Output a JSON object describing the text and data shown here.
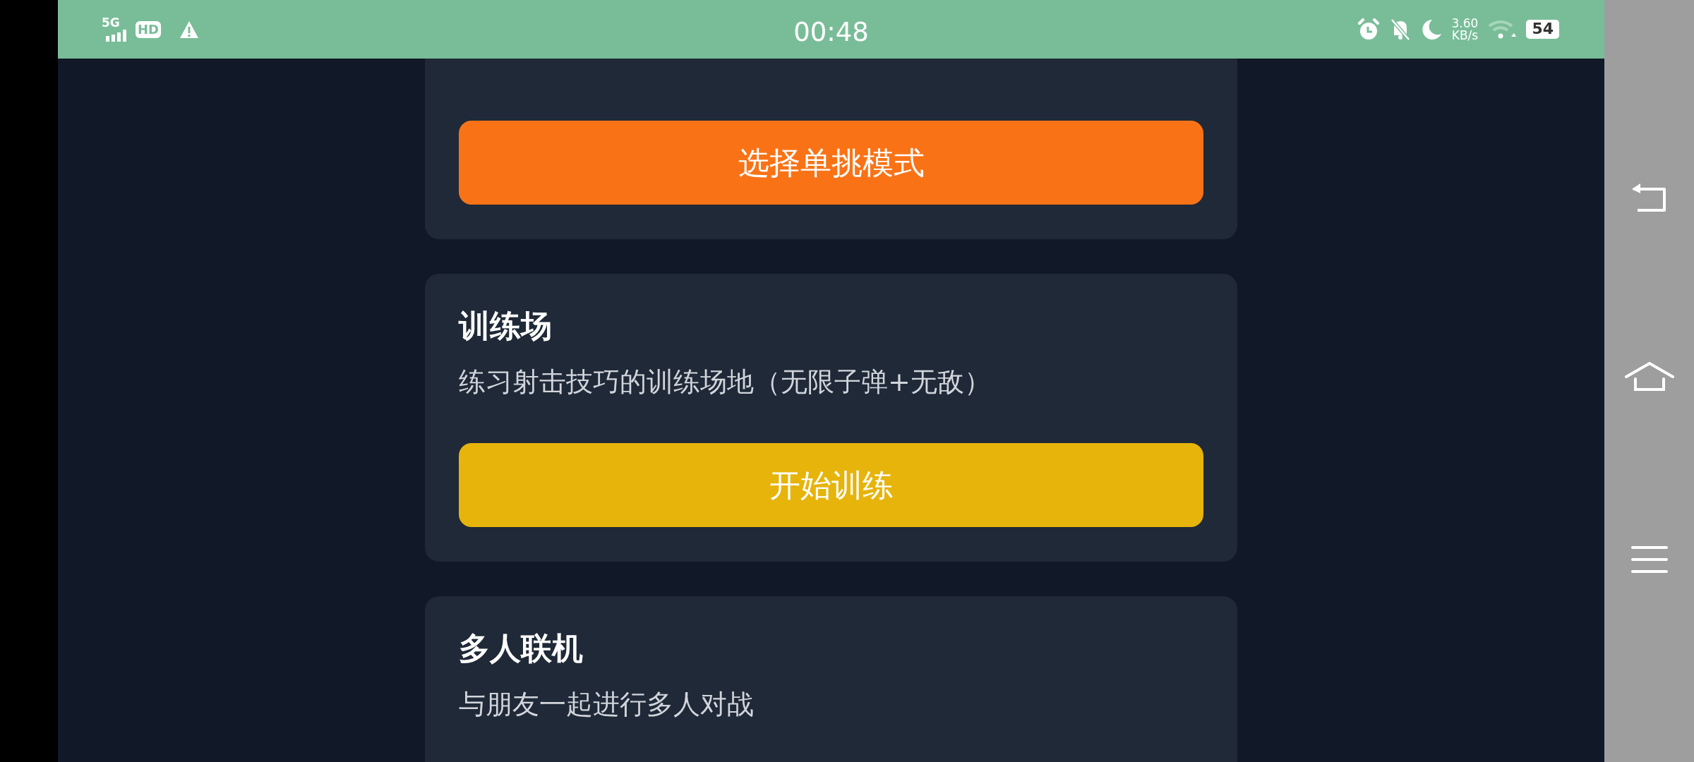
{
  "status_bar": {
    "network": "5G",
    "hd": "HD",
    "time": "00:48",
    "speed": "3.60",
    "speed_unit": "KB/s",
    "battery": "54"
  },
  "cards": [
    {
      "button": {
        "label": "选择单挑模式",
        "color": "#f97316"
      }
    },
    {
      "title": "训练场",
      "description": "练习射击技巧的训练场地（无限子弹+无敌）",
      "button": {
        "label": "开始训练",
        "color": "#e6b40a"
      }
    },
    {
      "title": "多人联机",
      "description": "与朋友一起进行多人对战"
    }
  ]
}
